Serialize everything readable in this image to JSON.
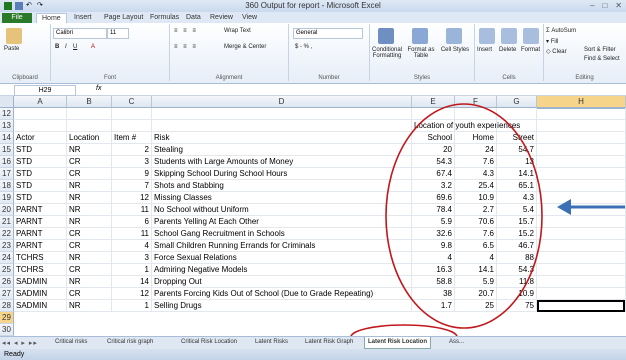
{
  "window": {
    "title": "360 Output for report - Microsoft Excel"
  },
  "ribbon_tabs": [
    "File",
    "Home",
    "Insert",
    "Page Layout",
    "Formulas",
    "Data",
    "Review",
    "View"
  ],
  "ribbon": {
    "paste": "Paste",
    "clipboard": "Clipboard",
    "font_name": "Calibri",
    "font_size": "11",
    "font": "Font",
    "wrap_text": "Wrap Text",
    "merge_center": "Merge & Center",
    "alignment": "Alignment",
    "number_format": "General",
    "number": "Number",
    "conditional_formatting": "Conditional Formatting",
    "format_as_table": "Format as Table",
    "cell_styles": "Cell Styles",
    "styles": "Styles",
    "insert": "Insert",
    "delete": "Delete",
    "format": "Format",
    "cells": "Cells",
    "autosum": "AutoSum",
    "fill": "Fill",
    "clear": "Clear",
    "sort_filter": "Sort & Filter",
    "find_select": "Find & Select",
    "editing": "Editing"
  },
  "formula_bar": {
    "name_box": "H29",
    "fx": "fx",
    "value": ""
  },
  "columns": [
    "A",
    "B",
    "C",
    "D",
    "E",
    "F",
    "G",
    "H"
  ],
  "header_rows": [
    {
      "num": "12",
      "a": "",
      "b": "",
      "c": "",
      "d": "",
      "e": "",
      "f": "",
      "g": ""
    },
    {
      "num": "13",
      "a": "",
      "b": "",
      "c": "",
      "d": "",
      "e": "Location of youth experiences",
      "f": "",
      "g": ""
    },
    {
      "num": "14",
      "a": "Actor",
      "b": "Location",
      "c": "Item #",
      "d": "Risk",
      "e": "School",
      "f": "Home",
      "g": "Street"
    }
  ],
  "rows": [
    {
      "num": "15",
      "a": "STD",
      "b": "NR",
      "c": "2",
      "d": "Stealing",
      "e": "20",
      "f": "24",
      "g": "54.7"
    },
    {
      "num": "16",
      "a": "STD",
      "b": "CR",
      "c": "3",
      "d": "Students with Large Amounts of Money",
      "e": "54.3",
      "f": "7.6",
      "g": "13"
    },
    {
      "num": "17",
      "a": "STD",
      "b": "CR",
      "c": "9",
      "d": "Skipping School During School Hours",
      "e": "67.4",
      "f": "4.3",
      "g": "14.1"
    },
    {
      "num": "18",
      "a": "STD",
      "b": "NR",
      "c": "7",
      "d": "Shots and Stabbing",
      "e": "3.2",
      "f": "25.4",
      "g": "65.1"
    },
    {
      "num": "19",
      "a": "STD",
      "b": "NR",
      "c": "12",
      "d": "Missing Classes",
      "e": "69.6",
      "f": "10.9",
      "g": "4.3"
    },
    {
      "num": "20",
      "a": "PARNT",
      "b": "NR",
      "c": "11",
      "d": "No School without Uniform",
      "e": "78.4",
      "f": "2.7",
      "g": "5.4"
    },
    {
      "num": "21",
      "a": "PARNT",
      "b": "NR",
      "c": "6",
      "d": "Parents Yelling At Each Other",
      "e": "5.9",
      "f": "70.6",
      "g": "15.7"
    },
    {
      "num": "22",
      "a": "PARNT",
      "b": "CR",
      "c": "11",
      "d": "School Gang Recruitment in Schools",
      "e": "32.6",
      "f": "7.6",
      "g": "15.2"
    },
    {
      "num": "23",
      "a": "PARNT",
      "b": "CR",
      "c": "4",
      "d": "Small Children Running Errands for Criminals",
      "e": "9.8",
      "f": "6.5",
      "g": "46.7"
    },
    {
      "num": "24",
      "a": "TCHRS",
      "b": "NR",
      "c": "3",
      "d": "Force Sexual Relations",
      "e": "4",
      "f": "4",
      "g": "88"
    },
    {
      "num": "25",
      "a": "TCHRS",
      "b": "CR",
      "c": "1",
      "d": "Admiring Negative Models",
      "e": "16.3",
      "f": "14.1",
      "g": "54.3"
    },
    {
      "num": "26",
      "a": "SADMIN",
      "b": "NR",
      "c": "14",
      "d": "Dropping Out",
      "e": "58.8",
      "f": "5.9",
      "g": "11.8"
    },
    {
      "num": "27",
      "a": "SADMIN",
      "b": "CR",
      "c": "12",
      "d": "Parents Forcing Kids Out of School (Due to Grade Repeating)",
      "e": "38",
      "f": "20.7",
      "g": "10.9"
    },
    {
      "num": "28",
      "a": "SADMIN",
      "b": "NR",
      "c": "1",
      "d": "Selling Drugs",
      "e": "1.7",
      "f": "25",
      "g": "75"
    }
  ],
  "extra_rows": [
    "29",
    "30"
  ],
  "sheet_tabs": [
    "Critical risks",
    "Critical risk graph",
    "Critical Risk Location",
    "Latent Risks",
    "Latent Risk Graph",
    "Latent Risk Location",
    "Ass..."
  ],
  "active_sheet": "Latent Risk Location",
  "status": {
    "ready": "Ready"
  },
  "colors": {
    "annotation_red": "#c0181c",
    "arrow_blue": "#3b6fb6",
    "selection": "#f6d58a"
  }
}
